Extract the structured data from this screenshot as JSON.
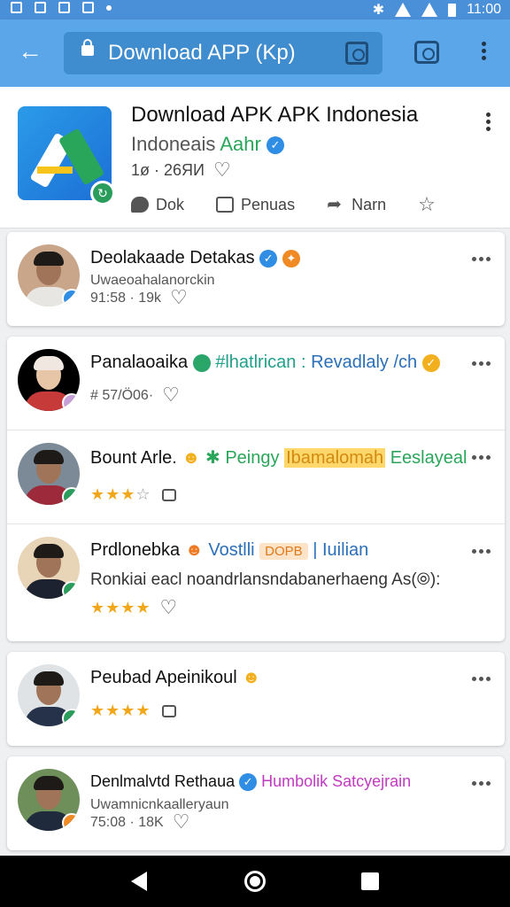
{
  "statusbar": {
    "time": "11:00"
  },
  "appbar": {
    "url": "Download APP (Kp)"
  },
  "app": {
    "title": "Download APK APK Indonesia",
    "developer_a": "Indoneais",
    "developer_b": "Aahr",
    "meta": "1ø · 26ЯИ",
    "actions": [
      {
        "label": "Dok"
      },
      {
        "label": "Penuas"
      },
      {
        "label": "Narn"
      }
    ]
  },
  "rows": [
    {
      "title": "Deolakaade Detakas",
      "line2": "Uwaeoahalanorckin",
      "line3": "91:58 · 19k",
      "badge": "✓"
    },
    {
      "title": "Panalaoaika",
      "teal": "#lhatlrican :",
      "blue": "Revadlaly /ch",
      "line3": "# 57/Ö06·",
      "badge": "✓"
    },
    {
      "title": "Bount Arle.",
      "green1": "Peingy",
      "highlight": "Ibamalomah",
      "green2": "Eeslayeal",
      "badge": "✓",
      "rating": 3
    },
    {
      "title": "Prdlonebka",
      "blue": "Vostlli",
      "tag": "DOPB",
      "blue2": "| Iuilian",
      "line2": "Ronkiai eacl noandrlansndabanerhaeng As(⦾):",
      "badge": "✓",
      "rating": 4
    },
    {
      "title": "Peubad Apeinikoul",
      "badge": "✓",
      "rating": 4
    },
    {
      "title": "Denlmalvtd Rethaua",
      "magenta": "Humbolik Satcyejrain",
      "line2": "Uwamnicnkaalleryaun",
      "line3": "75:08 · 18K",
      "badge": "✓"
    }
  ]
}
